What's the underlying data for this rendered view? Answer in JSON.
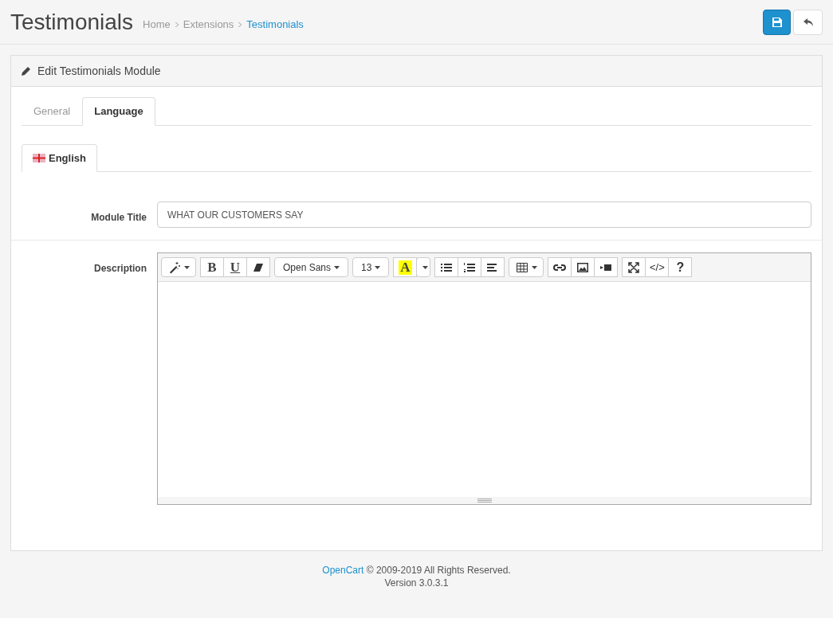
{
  "page_header": {
    "title": "Testimonials",
    "breadcrumb": [
      {
        "label": "Home",
        "current": false
      },
      {
        "label": "Extensions",
        "current": false
      },
      {
        "label": "Testimonials",
        "current": true
      }
    ]
  },
  "panel": {
    "title": "Edit Testimonials Module",
    "tabs": [
      {
        "label": "General",
        "selected": false
      },
      {
        "label": "Language",
        "selected": true
      }
    ],
    "language_tabs": [
      {
        "label": "English",
        "selected": true
      }
    ],
    "fields": [
      {
        "kind": "input",
        "label": "Module Title",
        "value": "WHAT OUR CUSTOMERS SAY"
      },
      {
        "kind": "editor",
        "label": "Description"
      }
    ],
    "editor_toolbar": [
      [
        {
          "kind": "magic"
        }
      ],
      [
        {
          "kind": "bold",
          "label": "B"
        },
        {
          "kind": "underline",
          "label": "U"
        },
        {
          "kind": "eraser"
        }
      ],
      [
        {
          "kind": "dropdown",
          "label": "Open Sans"
        }
      ],
      [
        {
          "kind": "dropdown",
          "label": "13"
        }
      ],
      [
        {
          "kind": "color",
          "label": "A"
        },
        {
          "kind": "caret"
        }
      ],
      [
        {
          "kind": "bullets"
        },
        {
          "kind": "numbers"
        },
        {
          "kind": "align"
        }
      ],
      [
        {
          "kind": "table"
        }
      ],
      [
        {
          "kind": "link"
        },
        {
          "kind": "picture"
        },
        {
          "kind": "video"
        }
      ],
      [
        {
          "kind": "fullscreen"
        },
        {
          "kind": "code",
          "label": "</>"
        },
        {
          "kind": "help",
          "label": "?"
        }
      ]
    ]
  },
  "footer": {
    "link": "OpenCart",
    "text": "© 2009-2019 All Rights Reserved.",
    "version": "Version 3.0.3.1"
  }
}
